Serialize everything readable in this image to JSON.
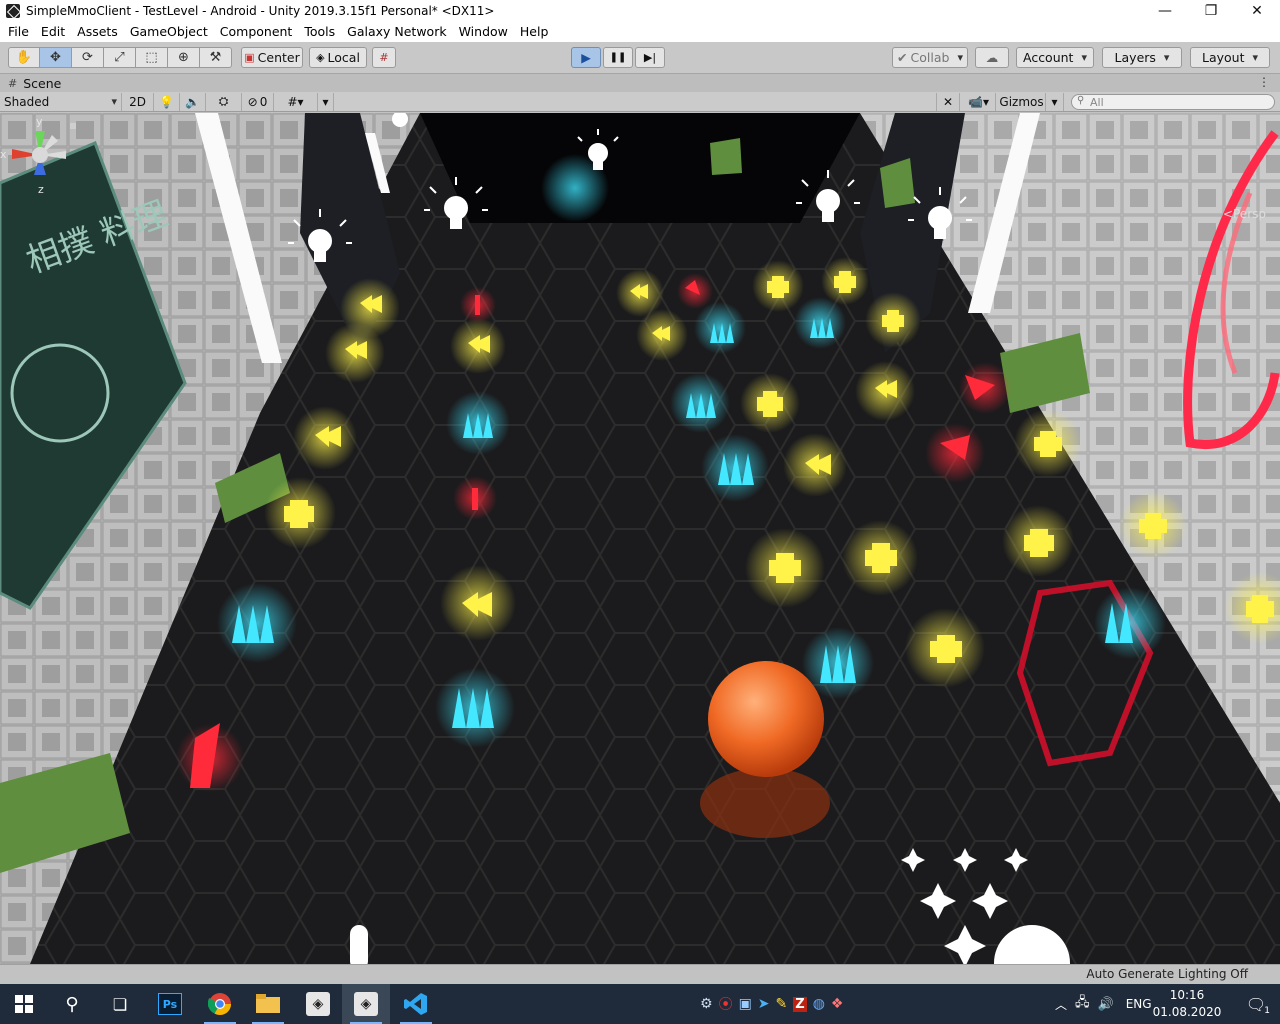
{
  "window": {
    "title": "SimpleMmoClient - TestLevel - Android - Unity 2019.3.15f1 Personal* <DX11>",
    "minimize_glyph": "—",
    "maximize_glyph": "❐",
    "close_glyph": "✕"
  },
  "menu": {
    "items": [
      "File",
      "Edit",
      "Assets",
      "GameObject",
      "Component",
      "Tools",
      "Galaxy Network",
      "Window",
      "Help"
    ]
  },
  "toolbar": {
    "tools": [
      "hand-icon",
      "move-icon",
      "rotate-icon",
      "scale-icon",
      "rect-icon",
      "transform-icon",
      "custom-tool-icon"
    ],
    "pivot_label": "Center",
    "space_label": "Local",
    "collab_label": "Collab",
    "account_label": "Account",
    "layers_label": "Layers",
    "layout_label": "Layout"
  },
  "scene_tab": {
    "label": "Scene"
  },
  "scene_toolbar": {
    "shading_mode": "Shaded",
    "mode_2d_label": "2D",
    "hidden_count": "0",
    "gizmos_label": "Gizmos",
    "search_placeholder": "All"
  },
  "viewport": {
    "camera_mode": "Persp",
    "axis_x": "x",
    "axis_y": "y",
    "axis_z": "z",
    "sign_text": "相撲 料理"
  },
  "status": {
    "text": "Auto Generate Lighting Off"
  },
  "taskbar": {
    "language": "ENG",
    "time": "10:16",
    "date": "01.08.2020",
    "notification_count": "1",
    "ps_label": "Ps"
  },
  "colors": {
    "accent": "#4a7fc1",
    "taskbar": "#1f2b3a"
  }
}
